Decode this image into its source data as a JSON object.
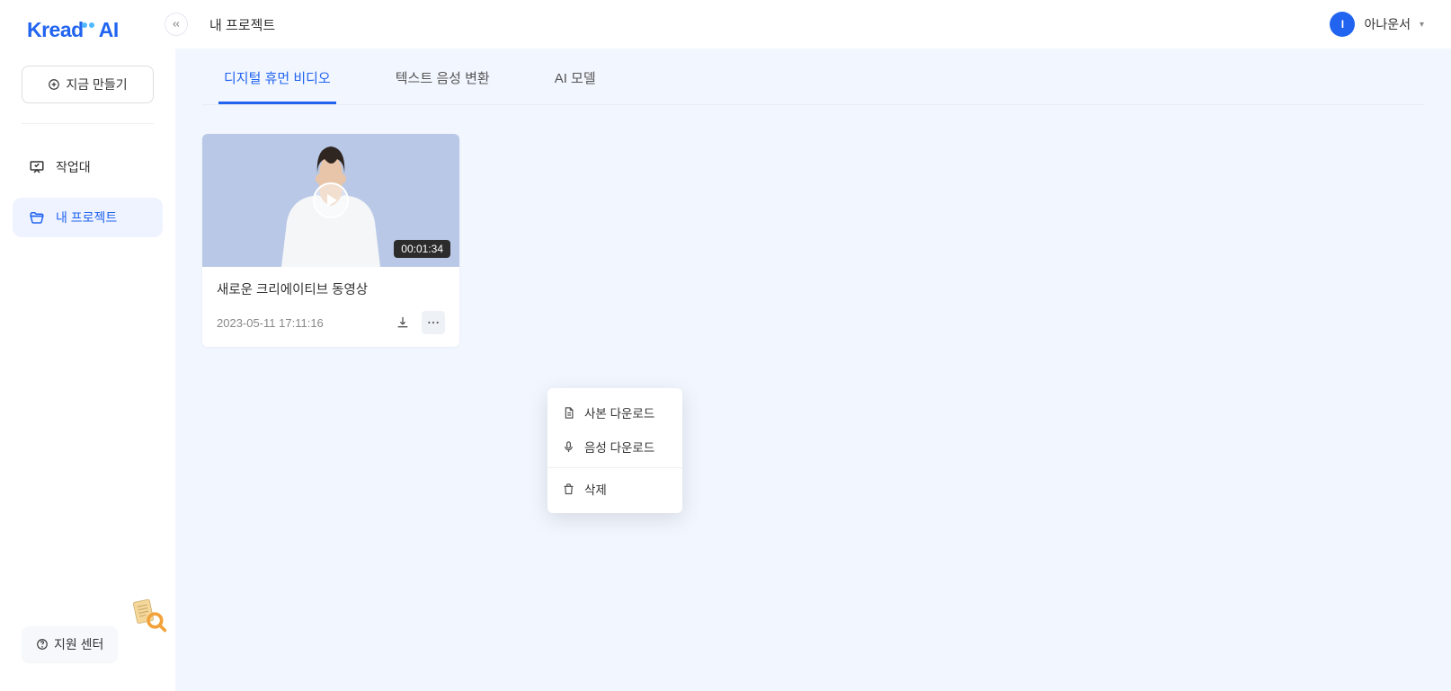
{
  "logo": {
    "text": "Kreado AI"
  },
  "sidebar": {
    "create_label": "지금 만들기",
    "nav": [
      {
        "label": "작업대"
      },
      {
        "label": "내 프로젝트"
      }
    ],
    "support_label": "지원 센터"
  },
  "topbar": {
    "page_title": "내 프로젝트",
    "user": {
      "avatar_initial": "I",
      "name": "아나운서"
    }
  },
  "tabs": [
    {
      "label": "디지털 휴먼 비디오"
    },
    {
      "label": "텍스트 음성 변환"
    },
    {
      "label": "AI 모델"
    }
  ],
  "cards": [
    {
      "title": "새로운 크리에이티브 동영상",
      "date": "2023-05-11 17:11:16",
      "duration": "00:01:34"
    }
  ],
  "menu": {
    "copy": "사본 다운로드",
    "voice": "음성 다운로드",
    "delete": "삭제"
  }
}
